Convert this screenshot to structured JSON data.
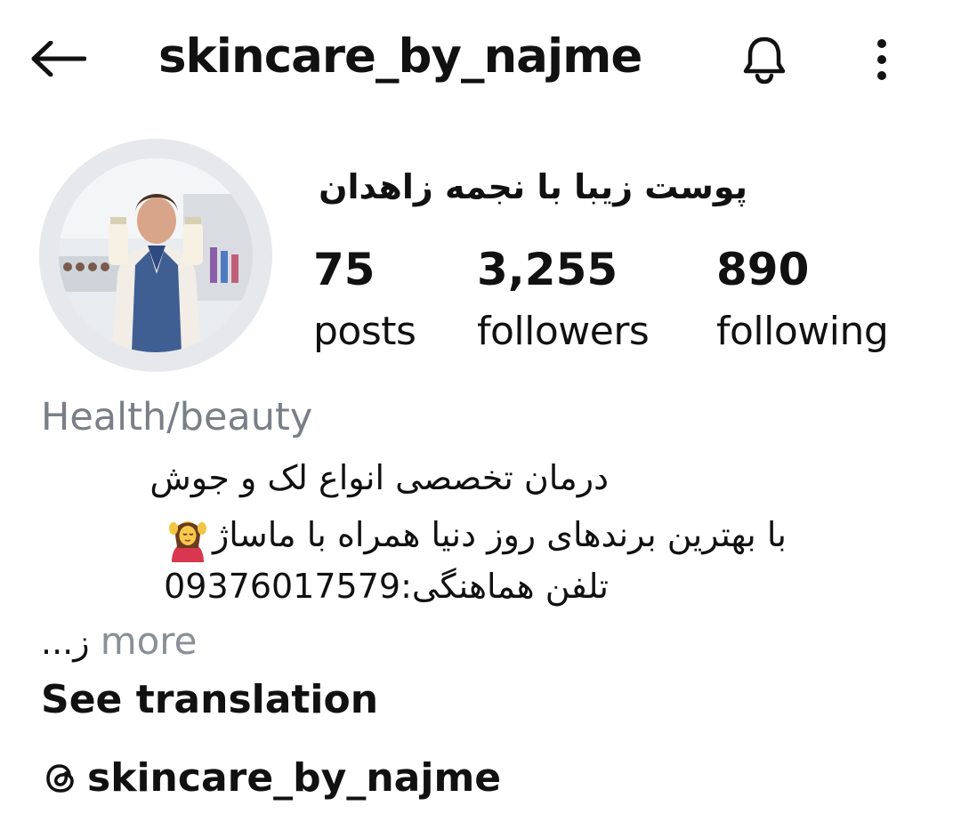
{
  "header": {
    "username": "skincare_by_najme",
    "back_icon": "arrow-left-icon",
    "bell_icon": "bell-icon",
    "more_icon": "more-vertical-icon"
  },
  "profile": {
    "display_name": "پوست زیبا با نجمه زاهدان",
    "stats": {
      "posts": {
        "count": "75",
        "label": "posts"
      },
      "followers": {
        "count": "3,255",
        "label": "followers"
      },
      "following": {
        "count": "890",
        "label": "following"
      }
    },
    "category": "Health/beauty",
    "bio": {
      "line1": "درمان تخصصی انواع لک و جوش",
      "line2": "با بهترین برندهای روز دنیا همراه با ماساژ",
      "line2_emoji": "person-getting-massage-emoji",
      "line3": "تلفن هماهنگی:09376017579",
      "line4_prefix": "ز...",
      "more_label": "more"
    },
    "see_translation": "See translation",
    "threads_handle": "skincare_by_najme",
    "threads_icon": "threads-icon"
  },
  "colors": {
    "text": "#111111",
    "muted": "#7a7f87",
    "avatar_ring": "#e6e8eb"
  }
}
